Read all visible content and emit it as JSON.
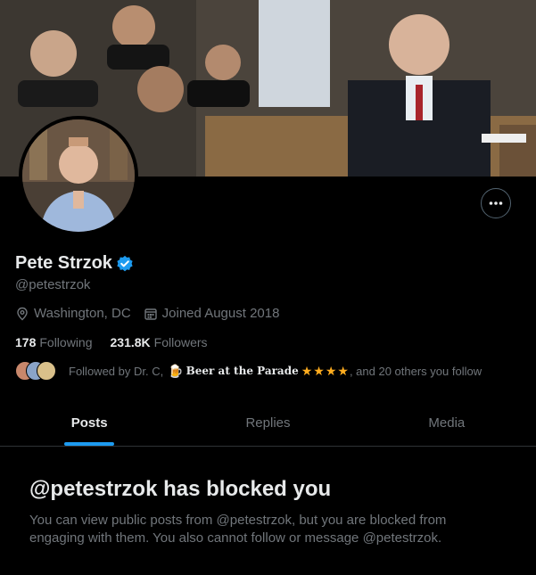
{
  "profile": {
    "name": "Pete Strzok",
    "handle": "@petestrzok",
    "location": "Washington, DC",
    "joined": "Joined August 2018",
    "following_count": "178",
    "following_label": "Following",
    "followers_count": "231.8K",
    "followers_label": "Followers",
    "followed_by_prefix": "Followed by Dr. C,",
    "followed_by_beer": "Beer at the Parade",
    "followed_by_stars": "★★★★",
    "followed_by_suffix": ", and 20 others you follow"
  },
  "tabs": [
    {
      "label": "Posts",
      "active": true
    },
    {
      "label": "Replies",
      "active": false
    },
    {
      "label": "Media",
      "active": false
    }
  ],
  "blocked": {
    "title": "@petestrzok has blocked you",
    "message": "You can view public posts from @petestrzok, but you are blocked from engaging with them. You also cannot follow or message @petestrzok."
  },
  "colors": {
    "background": "#000000",
    "accent": "#1d9bf0",
    "muted_text": "#71767b",
    "primary_text": "#e7e9ea",
    "star": "#ffad1f"
  },
  "icons": {
    "more": "more-dots-icon",
    "verified": "verified-badge-icon",
    "location": "location-pin-icon",
    "calendar": "calendar-icon"
  }
}
